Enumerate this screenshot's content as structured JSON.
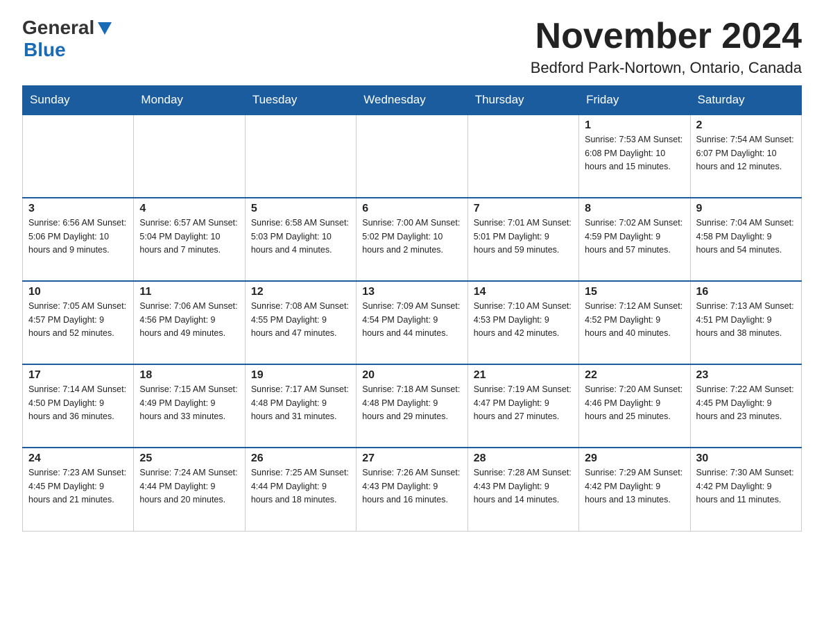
{
  "logo": {
    "general": "General",
    "blue": "Blue"
  },
  "header": {
    "month_year": "November 2024",
    "location": "Bedford Park-Nortown, Ontario, Canada"
  },
  "weekdays": [
    "Sunday",
    "Monday",
    "Tuesday",
    "Wednesday",
    "Thursday",
    "Friday",
    "Saturday"
  ],
  "weeks": [
    [
      {
        "day": "",
        "info": ""
      },
      {
        "day": "",
        "info": ""
      },
      {
        "day": "",
        "info": ""
      },
      {
        "day": "",
        "info": ""
      },
      {
        "day": "",
        "info": ""
      },
      {
        "day": "1",
        "info": "Sunrise: 7:53 AM\nSunset: 6:08 PM\nDaylight: 10 hours and 15 minutes."
      },
      {
        "day": "2",
        "info": "Sunrise: 7:54 AM\nSunset: 6:07 PM\nDaylight: 10 hours and 12 minutes."
      }
    ],
    [
      {
        "day": "3",
        "info": "Sunrise: 6:56 AM\nSunset: 5:06 PM\nDaylight: 10 hours and 9 minutes."
      },
      {
        "day": "4",
        "info": "Sunrise: 6:57 AM\nSunset: 5:04 PM\nDaylight: 10 hours and 7 minutes."
      },
      {
        "day": "5",
        "info": "Sunrise: 6:58 AM\nSunset: 5:03 PM\nDaylight: 10 hours and 4 minutes."
      },
      {
        "day": "6",
        "info": "Sunrise: 7:00 AM\nSunset: 5:02 PM\nDaylight: 10 hours and 2 minutes."
      },
      {
        "day": "7",
        "info": "Sunrise: 7:01 AM\nSunset: 5:01 PM\nDaylight: 9 hours and 59 minutes."
      },
      {
        "day": "8",
        "info": "Sunrise: 7:02 AM\nSunset: 4:59 PM\nDaylight: 9 hours and 57 minutes."
      },
      {
        "day": "9",
        "info": "Sunrise: 7:04 AM\nSunset: 4:58 PM\nDaylight: 9 hours and 54 minutes."
      }
    ],
    [
      {
        "day": "10",
        "info": "Sunrise: 7:05 AM\nSunset: 4:57 PM\nDaylight: 9 hours and 52 minutes."
      },
      {
        "day": "11",
        "info": "Sunrise: 7:06 AM\nSunset: 4:56 PM\nDaylight: 9 hours and 49 minutes."
      },
      {
        "day": "12",
        "info": "Sunrise: 7:08 AM\nSunset: 4:55 PM\nDaylight: 9 hours and 47 minutes."
      },
      {
        "day": "13",
        "info": "Sunrise: 7:09 AM\nSunset: 4:54 PM\nDaylight: 9 hours and 44 minutes."
      },
      {
        "day": "14",
        "info": "Sunrise: 7:10 AM\nSunset: 4:53 PM\nDaylight: 9 hours and 42 minutes."
      },
      {
        "day": "15",
        "info": "Sunrise: 7:12 AM\nSunset: 4:52 PM\nDaylight: 9 hours and 40 minutes."
      },
      {
        "day": "16",
        "info": "Sunrise: 7:13 AM\nSunset: 4:51 PM\nDaylight: 9 hours and 38 minutes."
      }
    ],
    [
      {
        "day": "17",
        "info": "Sunrise: 7:14 AM\nSunset: 4:50 PM\nDaylight: 9 hours and 36 minutes."
      },
      {
        "day": "18",
        "info": "Sunrise: 7:15 AM\nSunset: 4:49 PM\nDaylight: 9 hours and 33 minutes."
      },
      {
        "day": "19",
        "info": "Sunrise: 7:17 AM\nSunset: 4:48 PM\nDaylight: 9 hours and 31 minutes."
      },
      {
        "day": "20",
        "info": "Sunrise: 7:18 AM\nSunset: 4:48 PM\nDaylight: 9 hours and 29 minutes."
      },
      {
        "day": "21",
        "info": "Sunrise: 7:19 AM\nSunset: 4:47 PM\nDaylight: 9 hours and 27 minutes."
      },
      {
        "day": "22",
        "info": "Sunrise: 7:20 AM\nSunset: 4:46 PM\nDaylight: 9 hours and 25 minutes."
      },
      {
        "day": "23",
        "info": "Sunrise: 7:22 AM\nSunset: 4:45 PM\nDaylight: 9 hours and 23 minutes."
      }
    ],
    [
      {
        "day": "24",
        "info": "Sunrise: 7:23 AM\nSunset: 4:45 PM\nDaylight: 9 hours and 21 minutes."
      },
      {
        "day": "25",
        "info": "Sunrise: 7:24 AM\nSunset: 4:44 PM\nDaylight: 9 hours and 20 minutes."
      },
      {
        "day": "26",
        "info": "Sunrise: 7:25 AM\nSunset: 4:44 PM\nDaylight: 9 hours and 18 minutes."
      },
      {
        "day": "27",
        "info": "Sunrise: 7:26 AM\nSunset: 4:43 PM\nDaylight: 9 hours and 16 minutes."
      },
      {
        "day": "28",
        "info": "Sunrise: 7:28 AM\nSunset: 4:43 PM\nDaylight: 9 hours and 14 minutes."
      },
      {
        "day": "29",
        "info": "Sunrise: 7:29 AM\nSunset: 4:42 PM\nDaylight: 9 hours and 13 minutes."
      },
      {
        "day": "30",
        "info": "Sunrise: 7:30 AM\nSunset: 4:42 PM\nDaylight: 9 hours and 11 minutes."
      }
    ]
  ]
}
